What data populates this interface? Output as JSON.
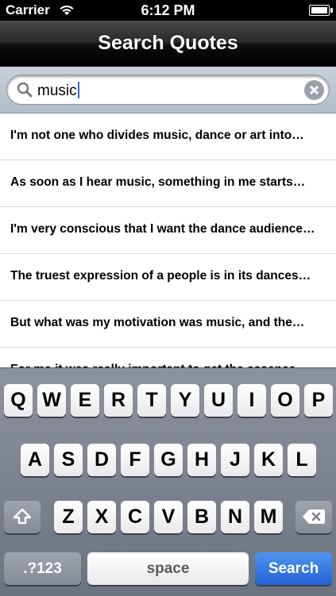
{
  "status": {
    "carrier": "Carrier",
    "time": "6:12 PM"
  },
  "nav": {
    "title": "Search Quotes"
  },
  "search": {
    "query": "music"
  },
  "results": [
    "I'm not one who divides music, dance or art into…",
    "As soon as I hear music, something in me starts…",
    "I'm very conscious that I want the dance audience…",
    "The truest expression of a people is in its dances…",
    "But what was my motivation was music, and the…",
    "For me it was really important to get the essence…"
  ],
  "keyboard": {
    "row1": [
      "Q",
      "W",
      "E",
      "R",
      "T",
      "Y",
      "U",
      "I",
      "O",
      "P"
    ],
    "row2": [
      "A",
      "S",
      "D",
      "F",
      "G",
      "H",
      "J",
      "K",
      "L"
    ],
    "row3": [
      "Z",
      "X",
      "C",
      "V",
      "B",
      "N",
      "M"
    ],
    "numbers_label": ".?123",
    "space_label": "space",
    "search_label": "Search"
  }
}
